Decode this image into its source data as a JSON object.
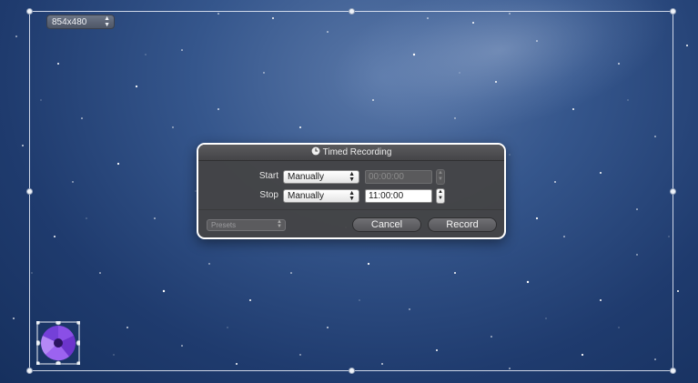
{
  "capture": {
    "resolution": "854x480"
  },
  "dialog": {
    "title": "Timed Recording",
    "start_label": "Start",
    "start_mode": "Manually",
    "start_time": "00:00:00",
    "stop_label": "Stop",
    "stop_mode": "Manually",
    "stop_time": "11:00:00",
    "presets_label": "Presets",
    "cancel_label": "Cancel",
    "record_label": "Record"
  },
  "icons": {
    "clock": "clock-icon",
    "popup_arrows": "up-down-arrows-icon",
    "app": "app-logo-icon"
  },
  "colors": {
    "frame": "#eef2f8",
    "dialog_bg": "#444446",
    "app_icon": "#7b3fd6"
  }
}
